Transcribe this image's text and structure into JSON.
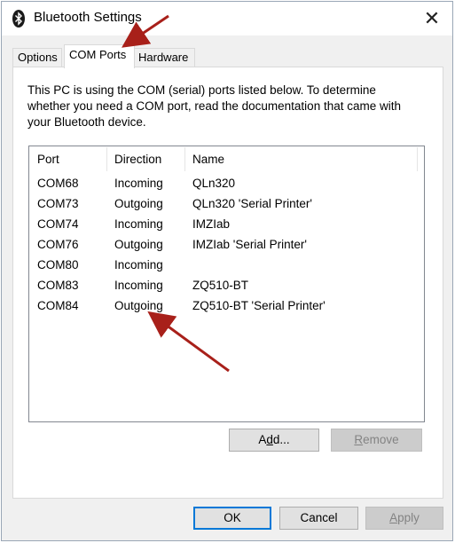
{
  "window": {
    "title": "Bluetooth Settings",
    "close_glyph": "✕"
  },
  "tabs": [
    {
      "label": "Options"
    },
    {
      "label": "COM Ports"
    },
    {
      "label": "Hardware"
    }
  ],
  "active_tab": "COM Ports",
  "description": "This PC is using the COM (serial) ports listed below. To determine whether you need a COM port, read the documentation that came with your Bluetooth device.",
  "table": {
    "columns": [
      "Port",
      "Direction",
      "Name"
    ],
    "rows": [
      {
        "port": "COM68",
        "direction": "Incoming",
        "name": "QLn320"
      },
      {
        "port": "COM73",
        "direction": "Outgoing",
        "name": "QLn320 'Serial Printer'"
      },
      {
        "port": "COM74",
        "direction": "Incoming",
        "name": "IMZIab"
      },
      {
        "port": "COM76",
        "direction": "Outgoing",
        "name": "IMZIab 'Serial Printer'"
      },
      {
        "port": "COM80",
        "direction": "Incoming",
        "name": ""
      },
      {
        "port": "COM83",
        "direction": "Incoming",
        "name": "ZQ510-BT"
      },
      {
        "port": "COM84",
        "direction": "Outgoing",
        "name": "ZQ510-BT 'Serial Printer'"
      }
    ]
  },
  "buttons": {
    "add": {
      "pre": "A",
      "mnemonic": "d",
      "post": "d..."
    },
    "remove": {
      "pre": "",
      "mnemonic": "R",
      "post": "emove",
      "enabled": false
    },
    "ok": "OK",
    "cancel": "Cancel",
    "apply": {
      "pre": "",
      "mnemonic": "A",
      "post": "pply",
      "enabled": false
    }
  },
  "colors": {
    "annotation_arrow": "#a8201a",
    "focus_border": "#0078d7",
    "bluetooth_icon": "#1a1a1a"
  }
}
